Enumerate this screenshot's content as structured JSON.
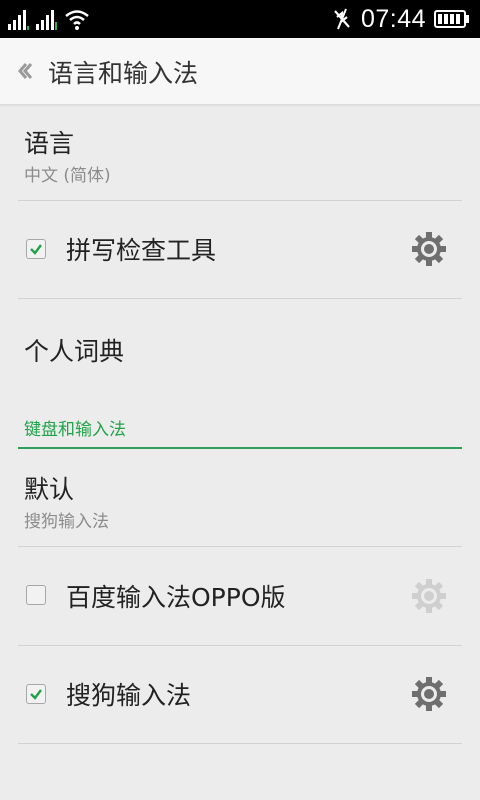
{
  "status": {
    "time": "07:44",
    "icons": [
      "signal-icon",
      "signal-icon",
      "wifi-icon",
      "vibrate-off-icon",
      "battery-icon"
    ]
  },
  "header": {
    "title": "语言和输入法",
    "back_icon": "chevron-left-icon"
  },
  "language": {
    "label": "语言",
    "value": "中文 (简体)"
  },
  "spellcheck": {
    "label": "拼写检查工具",
    "checked": true
  },
  "dictionary": {
    "label": "个人词典"
  },
  "keyboard_section": {
    "title": "键盘和输入法",
    "default": {
      "label": "默认",
      "value": "搜狗输入法"
    },
    "methods": [
      {
        "label": "百度输入法OPPO版",
        "checked": false,
        "settings_enabled": false
      },
      {
        "label": "搜狗输入法",
        "checked": true,
        "settings_enabled": true
      }
    ]
  },
  "colors": {
    "accent": "#21a34a",
    "background": "#ececec"
  }
}
